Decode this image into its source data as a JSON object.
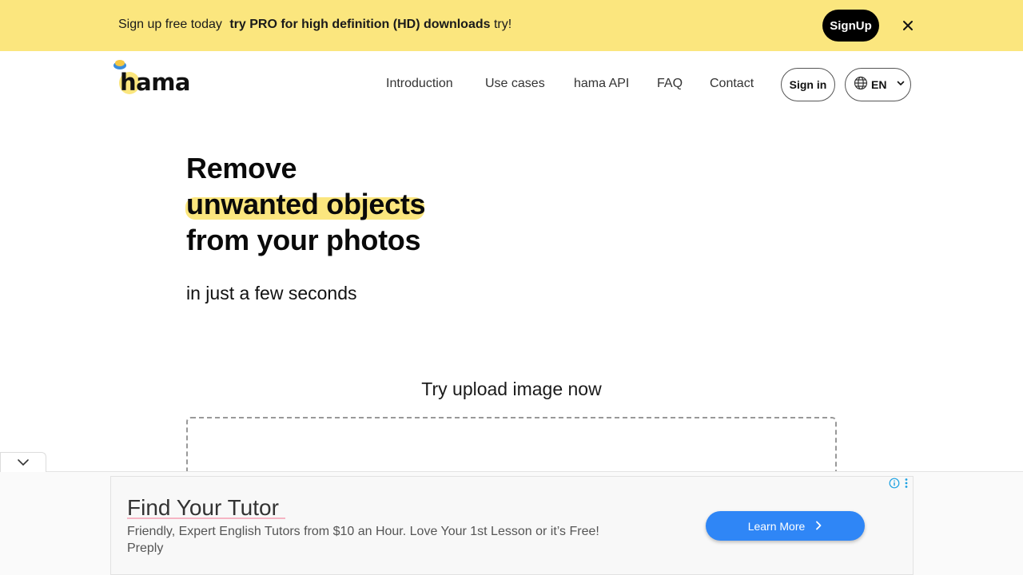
{
  "promo": {
    "text_lead": "Sign up free today",
    "text_bold": "try PRO for high definition (HD) downloads",
    "text_tail": "try!",
    "signup_label": "SignUp",
    "close_icon": "close-icon"
  },
  "header": {
    "logo_text": "hama",
    "nav": [
      "Introduction",
      "Use cases",
      "hama API",
      "FAQ",
      "Contact"
    ],
    "signin_label": "Sign in",
    "language": "EN",
    "globe_icon": "globe-icon",
    "chevron_icon": "chevron-down-icon"
  },
  "hero": {
    "line1": "Remove",
    "line2": "unwanted objects",
    "line3": "from your photos",
    "subtitle": "in just a few seconds"
  },
  "upload": {
    "title": "Try upload image now"
  },
  "ad": {
    "collapse_icon": "chevron-down-icon",
    "title": "Find Your Tutor",
    "description": "Friendly, Expert English Tutors from $10 an Hour. Love Your 1st Lesson or it’s Free!",
    "brand": "Preply",
    "cta_label": "Learn More",
    "info_icon": "info-icon",
    "menu_icon": "more-vertical-icon"
  },
  "colors": {
    "accent_yellow": "#fbe67e",
    "cta_blue": "#2f86f6"
  }
}
